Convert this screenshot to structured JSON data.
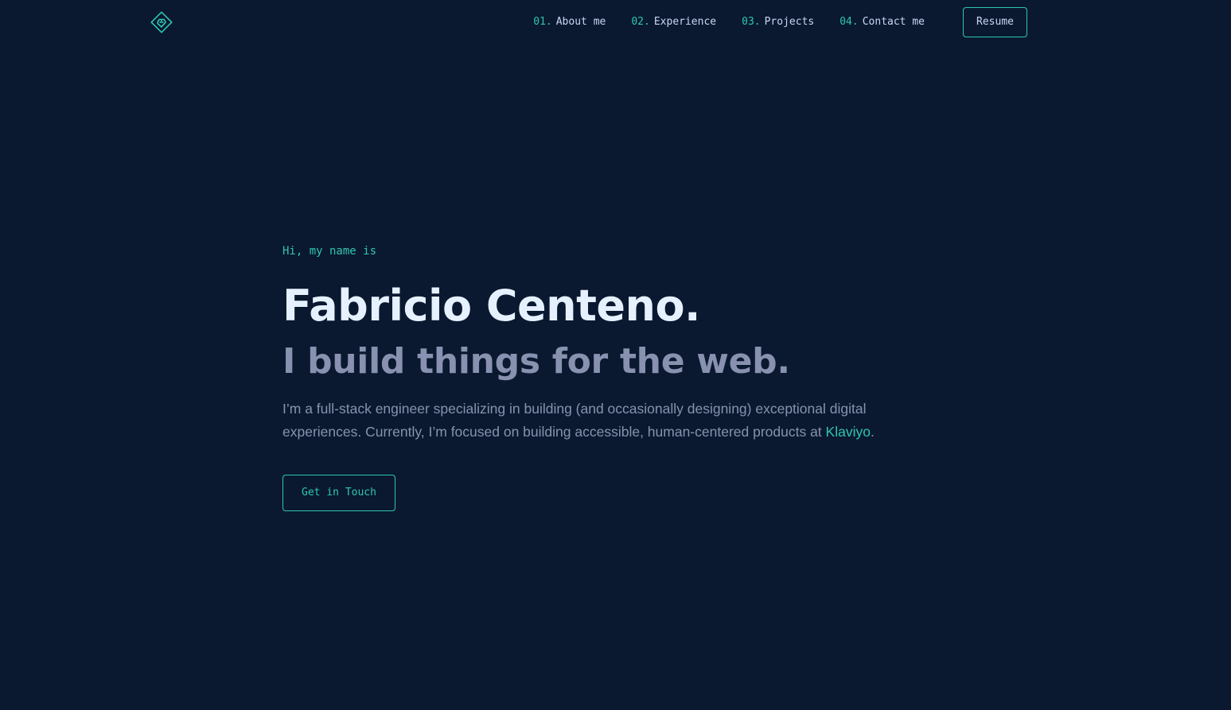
{
  "colors": {
    "background": "#0a192f",
    "accent": "#2fc6b0",
    "heading": "#e6f1ff",
    "text": "#8892b0",
    "nav_text": "#ccd6f6"
  },
  "header": {
    "logo_icon": "diamond-logo-icon",
    "nav": [
      {
        "num": "01.",
        "label": "About me"
      },
      {
        "num": "02.",
        "label": "Experience"
      },
      {
        "num": "03.",
        "label": "Projects"
      },
      {
        "num": "04.",
        "label": "Contact me"
      }
    ],
    "resume_label": "Resume"
  },
  "hero": {
    "greeting": "Hi, my name is",
    "name": "Fabricio Centeno.",
    "tagline": "I build things for the web.",
    "bio_before": "I’m a full-stack engineer specializing in building (and occasionally designing) exceptional digital experiences. Currently, I’m focused on building accessible, human-centered products at ",
    "bio_link": "Klaviyo",
    "bio_after": ".",
    "cta_label": "Get in Touch"
  }
}
